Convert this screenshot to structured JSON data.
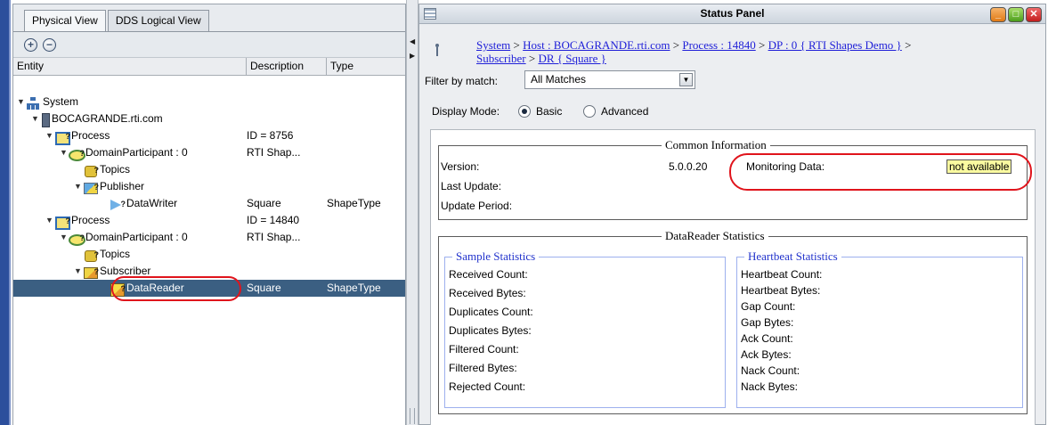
{
  "left_panel": {
    "tabs": [
      {
        "label": "Physical View",
        "active": true
      },
      {
        "label": "DDS Logical View",
        "active": false
      }
    ],
    "toolbar": {
      "expand_symbol": "+",
      "collapse_symbol": "−"
    },
    "columns": {
      "entity": "Entity",
      "description": "Description",
      "type": "Type"
    },
    "tree": [
      {
        "label": "System",
        "desc": "",
        "type": "",
        "icon": "system-icon"
      },
      {
        "label": "BOCAGRANDE.rti.com",
        "desc": "",
        "type": "",
        "icon": "host-icon"
      },
      {
        "label": "Process",
        "desc": "ID = 8756",
        "type": "",
        "icon": "process-icon"
      },
      {
        "label": "DomainParticipant : 0",
        "desc": "RTI Shap...",
        "type": "",
        "icon": "domain-participant-icon"
      },
      {
        "label": "Topics",
        "desc": "",
        "type": "",
        "icon": "topics-icon"
      },
      {
        "label": "Publisher",
        "desc": "",
        "type": "",
        "icon": "publisher-icon"
      },
      {
        "label": "DataWriter",
        "desc": "Square",
        "type": "ShapeType",
        "icon": "datawriter-icon"
      },
      {
        "label": "Process",
        "desc": "ID = 14840",
        "type": "",
        "icon": "process-icon"
      },
      {
        "label": "DomainParticipant : 0",
        "desc": "RTI Shap...",
        "type": "",
        "icon": "domain-participant-icon"
      },
      {
        "label": "Topics",
        "desc": "",
        "type": "",
        "icon": "topics-icon"
      },
      {
        "label": "Subscriber",
        "desc": "",
        "type": "",
        "icon": "subscriber-icon"
      },
      {
        "label": "DataReader",
        "desc": "Square",
        "type": "ShapeType",
        "icon": "datareader-icon",
        "selected": true
      }
    ]
  },
  "status_panel": {
    "title": "Status Panel",
    "breadcrumb": {
      "system": "System",
      "sep": " > ",
      "host": "Host : BOCAGRANDE.rti.com",
      "process": "Process : 14840",
      "dp": "DP : 0 { RTI Shapes Demo }",
      "subscriber": "Subscriber",
      "dr": "DR { Square }"
    },
    "filter": {
      "label": "Filter by match:",
      "value": "All Matches"
    },
    "display_mode": {
      "label": "Display Mode:",
      "basic": "Basic",
      "advanced": "Advanced",
      "selected": "Basic"
    },
    "common_info": {
      "title": "Common Information",
      "version_label": "Version:",
      "version_value": "5.0.0.20",
      "last_update_label": "Last Update:",
      "update_period_label": "Update Period:",
      "monitoring_label": "Monitoring Data:",
      "monitoring_value": "not available"
    },
    "datareader_stats": {
      "title": "DataReader Statistics",
      "sample": {
        "title": "Sample Statistics",
        "items": [
          "Received Count:",
          "Received Bytes:",
          "Duplicates Count:",
          "Duplicates Bytes:",
          "Filtered Count:",
          "Filtered Bytes:",
          "Rejected Count:"
        ]
      },
      "heartbeat": {
        "title": "Heartbeat Statistics",
        "items": [
          "Heartbeat Count:",
          "Heartbeat Bytes:",
          "Gap Count:",
          "Gap Bytes:",
          "Ack Count:",
          "Ack Bytes:",
          "Nack Count:",
          "Nack Bytes:"
        ]
      }
    }
  },
  "colors": {
    "selection": "#3b5f82",
    "highlight_ring": "#e0141c",
    "link": "#2020d8",
    "value_box": "#fafaa0"
  }
}
